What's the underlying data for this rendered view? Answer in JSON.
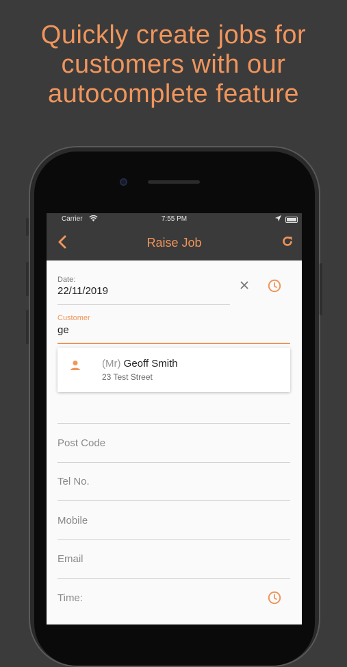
{
  "promo": {
    "line1": "Quickly create jobs for",
    "line2": "customers with our",
    "line3": "autocomplete feature"
  },
  "status_bar": {
    "carrier": "Carrier",
    "time": "7:55 PM"
  },
  "nav": {
    "title": "Raise Job",
    "back_icon": "chevron-left-icon",
    "refresh_icon": "refresh-icon"
  },
  "form": {
    "date": {
      "label": "Date:",
      "value": "22/11/2019"
    },
    "customer": {
      "label": "Customer",
      "value": "ge"
    },
    "post_code": {
      "placeholder": "Post Code"
    },
    "tel_no": {
      "placeholder": "Tel No."
    },
    "mobile": {
      "placeholder": "Mobile"
    },
    "email": {
      "placeholder": "Email"
    },
    "time": {
      "placeholder": "Time:"
    }
  },
  "suggestion": {
    "title": "(Mr)",
    "name": "Geoff Smith",
    "address": "23 Test Street"
  },
  "colors": {
    "accent": "#f0955c",
    "dark_bar": "#3a3a3a",
    "background": "#3b3b3b",
    "screen": "#fafafa"
  }
}
